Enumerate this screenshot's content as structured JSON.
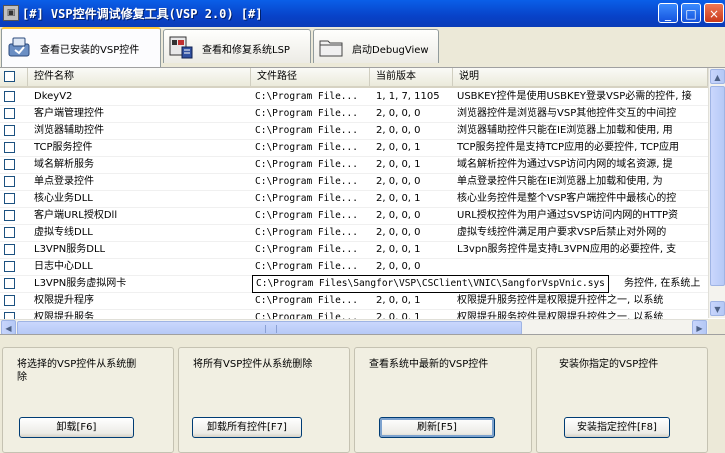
{
  "window": {
    "title": "[#] VSP控件调试修复工具(VSP 2.0) [#]",
    "app_icon": "app-icon",
    "controls": {
      "minimize": "_",
      "maximize": "□",
      "close": "×"
    }
  },
  "tabs": [
    {
      "label": "查看已安装的VSP控件",
      "icon": "installed-controls-icon",
      "active": true
    },
    {
      "label": "查看和修复系统LSP",
      "icon": "lsp-repair-icon",
      "active": false
    },
    {
      "label": "启动DebugView",
      "icon": "folder-icon",
      "active": false
    }
  ],
  "table": {
    "columns": [
      "控件名称",
      "文件路径",
      "当前版本",
      "说明"
    ],
    "rows": [
      {
        "name": "DkeyV2",
        "path": "C:\\Program File...",
        "version": "1, 1, 7, 1105",
        "desc": "USBKEY控件是使用USBKEY登录VSP必需的控件, 接"
      },
      {
        "name": "客户端管理控件",
        "path": "C:\\Program File...",
        "version": "2, 0, 0, 0",
        "desc": "浏览器控件是浏览器与VSP其他控件交互的中间控"
      },
      {
        "name": "浏览器辅助控件",
        "path": "C:\\Program File...",
        "version": "2, 0, 0, 0",
        "desc": "浏览器辅助控件只能在IE浏览器上加载和使用, 用"
      },
      {
        "name": "TCP服务控件",
        "path": "C:\\Program File...",
        "version": "2, 0, 0, 1",
        "desc": "TCP服务控件是支持TCP应用的必要控件, TCP应用"
      },
      {
        "name": "域名解析服务",
        "path": "C:\\Program File...",
        "version": "2, 0, 0, 1",
        "desc": "域名解析控件为通过VSP访问内网的域名资源, 提"
      },
      {
        "name": "单点登录控件",
        "path": "C:\\Program File...",
        "version": "2, 0, 0, 0",
        "desc": "单点登录控件只能在IE浏览器上加载和使用, 为"
      },
      {
        "name": "核心业务DLL",
        "path": "C:\\Program File...",
        "version": "2, 0, 0, 1",
        "desc": "核心业务控件是整个VSP客户端控件中最核心的控"
      },
      {
        "name": "客户端URL授权Dll",
        "path": "C:\\Program File...",
        "version": "2, 0, 0, 0",
        "desc": "URL授权控件为用户通过SVSP访问内网的HTTP资"
      },
      {
        "name": "虚拟专线DLL",
        "path": "C:\\Program File...",
        "version": "2, 0, 0, 0",
        "desc": "虚拟专线控件满足用户要求VSP后禁止对外网的"
      },
      {
        "name": "L3VPN服务DLL",
        "path": "C:\\Program File...",
        "version": "2, 0, 0, 1",
        "desc": "L3vpn服务控件是支持L3VPN应用的必要控件, 支"
      },
      {
        "name": "日志中心DLL",
        "path": "C:\\Program File...",
        "version": "2, 0, 0, 0",
        "desc": ""
      },
      {
        "name": "L3VPN服务虚拟网卡",
        "path": "",
        "version": "",
        "desc": "务控件, 在系统上"
      },
      {
        "name": "权限提升程序",
        "path": "C:\\Program File...",
        "version": "2, 0, 0, 1",
        "desc": "权限提升服务控件是权限提升控件之一, 以系统"
      },
      {
        "name": "权限提升服务",
        "path": "C:\\Program File...",
        "version": "2, 0, 0, 1",
        "desc": "权限提升服务控件是权限提升控件之一, 以系统"
      }
    ],
    "tooltip": "C:\\Program Files\\Sangfor\\VSP\\CSClient\\VNIC\\SangforVspVnic.sys"
  },
  "scrollbar": {
    "up": "▲",
    "down": "▼",
    "left": "◀",
    "right": "▶"
  },
  "panels": [
    {
      "text": "将选择的VSP控件从系统删除",
      "button": "卸载[F6]"
    },
    {
      "text": "将所有VSP控件从系统删除",
      "button": "卸载所有控件[F7]"
    },
    {
      "text": "查看系统中最新的VSP控件",
      "button": "刷新[F5]"
    },
    {
      "text": "安装你指定的VSP控件",
      "button": "安装指定控件[F8]"
    }
  ]
}
